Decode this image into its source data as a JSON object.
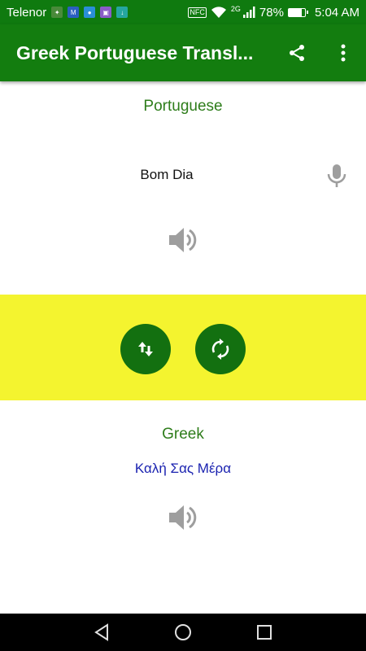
{
  "status_bar": {
    "carrier": "Telenor",
    "nfc": "NFC",
    "network": "2G",
    "battery_percent": "78%",
    "battery_level": 0.78,
    "time": "5:04 AM"
  },
  "app_bar": {
    "title": "Greek Portuguese Transl...",
    "actions": [
      "share-icon",
      "more-vert-icon"
    ]
  },
  "source": {
    "language": "Portuguese",
    "text": "Bom Dia"
  },
  "target": {
    "language": "Greek",
    "text": "Καλή Σας Μέρα"
  },
  "controls": {
    "buttons": [
      "swap-languages-icon",
      "refresh-icon"
    ]
  },
  "nav_bar": {
    "buttons": [
      "back-icon",
      "home-icon",
      "recents-icon"
    ]
  },
  "colors": {
    "primary": "#137d0f",
    "band": "#f4f42f",
    "accent_text": "#2e7d1b",
    "translation_text": "#1a22b0",
    "icon_gray": "#9e9e9e"
  }
}
